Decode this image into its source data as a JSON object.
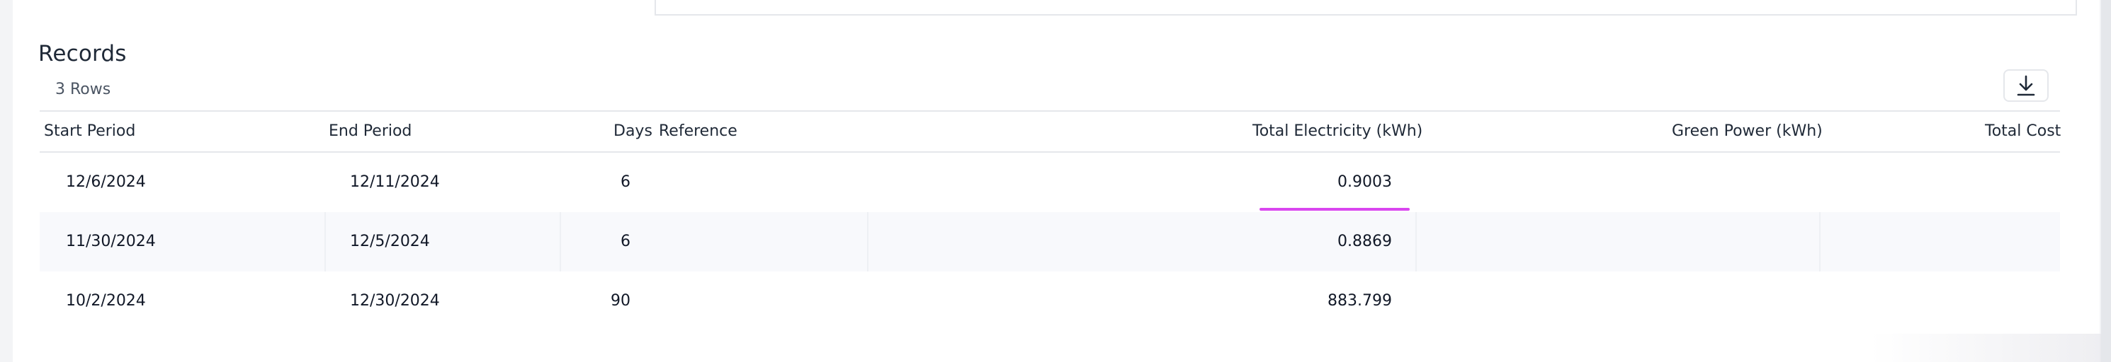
{
  "records": {
    "title": "Records",
    "row_count": "3 Rows"
  },
  "icons": {
    "download": "download-icon"
  },
  "columns": [
    {
      "label": "Start Period"
    },
    {
      "label": "End Period"
    },
    {
      "label": "Days"
    },
    {
      "label": "Reference"
    },
    {
      "label": "Total Electricity (kWh)"
    },
    {
      "label": "Green Power (kWh)"
    },
    {
      "label": "Total Cost"
    }
  ],
  "rows": [
    {
      "start": "12/6/2024",
      "end": "12/11/2024",
      "days": "6",
      "reference": "",
      "electricity": "0.9003",
      "green": "",
      "cost": ""
    },
    {
      "start": "11/30/2024",
      "end": "12/5/2024",
      "days": "6",
      "reference": "",
      "electricity": "0.8869",
      "green": "",
      "cost": ""
    },
    {
      "start": "10/2/2024",
      "end": "12/30/2024",
      "days": "90",
      "reference": "",
      "electricity": "883.799",
      "green": "",
      "cost": ""
    }
  ],
  "colors": {
    "highlight": "#d946ef",
    "alt_row": "#f8f9fc",
    "border": "#e5e7eb"
  }
}
